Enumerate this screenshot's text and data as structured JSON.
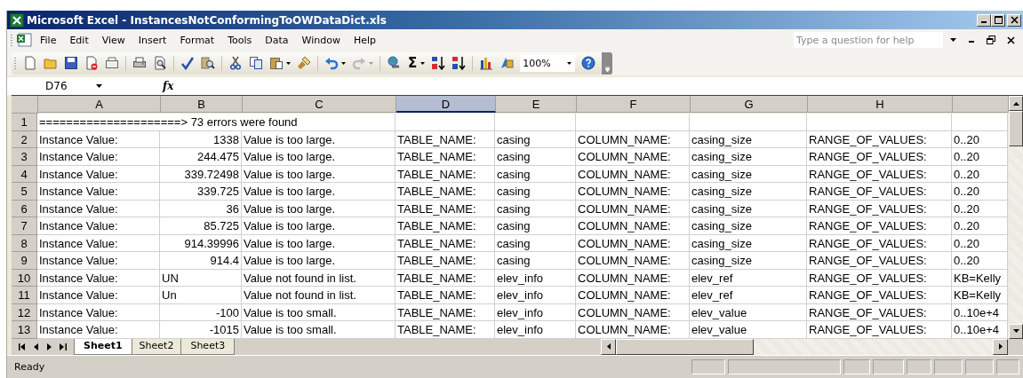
{
  "window": {
    "title": "Microsoft Excel - InstancesNotConformingToOWDataDict.xls"
  },
  "menu": [
    "File",
    "Edit",
    "View",
    "Insert",
    "Format",
    "Tools",
    "Data",
    "Window",
    "Help"
  ],
  "help_box": {
    "placeholder": "Type a question for help"
  },
  "toolbar": {
    "zoom": "100%",
    "sum_symbol": "Σ"
  },
  "name_box": {
    "value": "D76"
  },
  "formula_bar": {
    "fx": "fx"
  },
  "columns": [
    {
      "label": "A",
      "selected": false
    },
    {
      "label": "B",
      "selected": false
    },
    {
      "label": "C",
      "selected": false
    },
    {
      "label": "D",
      "selected": true
    },
    {
      "label": "E",
      "selected": false
    },
    {
      "label": "F",
      "selected": false
    },
    {
      "label": "G",
      "selected": false
    },
    {
      "label": "H",
      "selected": false
    }
  ],
  "rows": [
    {
      "num": "1",
      "kind": "banner",
      "text": "=====================> 73 errors were found"
    },
    {
      "num": "2",
      "kind": "data",
      "numeric": true,
      "cells": [
        "Instance Value:",
        "1338",
        "Value is too large.",
        "TABLE_NAME:",
        "casing",
        "COLUMN_NAME:",
        "casing_size",
        "RANGE_OF_VALUES:",
        "0..20"
      ]
    },
    {
      "num": "3",
      "kind": "data",
      "numeric": true,
      "cells": [
        "Instance Value:",
        "244.475",
        "Value is too large.",
        "TABLE_NAME:",
        "casing",
        "COLUMN_NAME:",
        "casing_size",
        "RANGE_OF_VALUES:",
        "0..20"
      ]
    },
    {
      "num": "4",
      "kind": "data",
      "numeric": true,
      "cells": [
        "Instance Value:",
        "339.72498",
        "Value is too large.",
        "TABLE_NAME:",
        "casing",
        "COLUMN_NAME:",
        "casing_size",
        "RANGE_OF_VALUES:",
        "0..20"
      ]
    },
    {
      "num": "5",
      "kind": "data",
      "numeric": true,
      "cells": [
        "Instance Value:",
        "339.725",
        "Value is too large.",
        "TABLE_NAME:",
        "casing",
        "COLUMN_NAME:",
        "casing_size",
        "RANGE_OF_VALUES:",
        "0..20"
      ]
    },
    {
      "num": "6",
      "kind": "data",
      "numeric": true,
      "cells": [
        "Instance Value:",
        "36",
        "Value is too large.",
        "TABLE_NAME:",
        "casing",
        "COLUMN_NAME:",
        "casing_size",
        "RANGE_OF_VALUES:",
        "0..20"
      ]
    },
    {
      "num": "7",
      "kind": "data",
      "numeric": true,
      "cells": [
        "Instance Value:",
        "85.725",
        "Value is too large.",
        "TABLE_NAME:",
        "casing",
        "COLUMN_NAME:",
        "casing_size",
        "RANGE_OF_VALUES:",
        "0..20"
      ]
    },
    {
      "num": "8",
      "kind": "data",
      "numeric": true,
      "cells": [
        "Instance Value:",
        "914.39996",
        "Value is too large.",
        "TABLE_NAME:",
        "casing",
        "COLUMN_NAME:",
        "casing_size",
        "RANGE_OF_VALUES:",
        "0..20"
      ]
    },
    {
      "num": "9",
      "kind": "data",
      "numeric": true,
      "cells": [
        "Instance Value:",
        "914.4",
        "Value is too large.",
        "TABLE_NAME:",
        "casing",
        "COLUMN_NAME:",
        "casing_size",
        "RANGE_OF_VALUES:",
        "0..20"
      ]
    },
    {
      "num": "10",
      "kind": "data",
      "numeric": false,
      "cells": [
        "Instance Value:",
        "UN",
        "Value not found in list.",
        "TABLE_NAME:",
        "elev_info",
        "COLUMN_NAME:",
        "elev_ref",
        "RANGE_OF_VALUES:",
        "KB=Kelly"
      ]
    },
    {
      "num": "11",
      "kind": "data",
      "numeric": false,
      "cells": [
        "Instance Value:",
        "Un",
        "Value not found in list.",
        "TABLE_NAME:",
        "elev_info",
        "COLUMN_NAME:",
        "elev_ref",
        "RANGE_OF_VALUES:",
        "KB=Kelly"
      ]
    },
    {
      "num": "12",
      "kind": "data",
      "numeric": true,
      "cells": [
        "Instance Value:",
        "-100",
        "Value is too small.",
        "TABLE_NAME:",
        "elev_info",
        "COLUMN_NAME:",
        "elev_value",
        "RANGE_OF_VALUES:",
        "0..10e+4"
      ]
    },
    {
      "num": "13",
      "kind": "data",
      "numeric": true,
      "cells": [
        "Instance Value:",
        "-1015",
        "Value is too small.",
        "TABLE_NAME:",
        "elev_info",
        "COLUMN_NAME:",
        "elev_value",
        "RANGE_OF_VALUES:",
        "0..10e+4"
      ]
    }
  ],
  "sheet_tabs": [
    {
      "label": "Sheet1",
      "selected": true
    },
    {
      "label": "Sheet2",
      "selected": false
    },
    {
      "label": "Sheet3",
      "selected": false
    }
  ],
  "status_bar": {
    "text": "Ready"
  }
}
